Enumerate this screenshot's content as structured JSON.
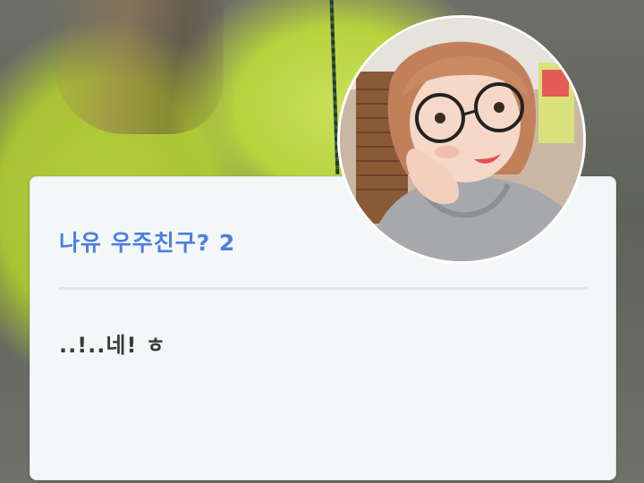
{
  "post": {
    "title": "나유 우주친구? 2",
    "body": "..!..네! ㅎ"
  },
  "profile": {
    "avatar_icon": "profile-photo"
  },
  "colors": {
    "title": "#4a7fe0",
    "card_background": "#f4f7f8",
    "divider": "#dae8ef",
    "body_text": "#3b3b3b"
  }
}
